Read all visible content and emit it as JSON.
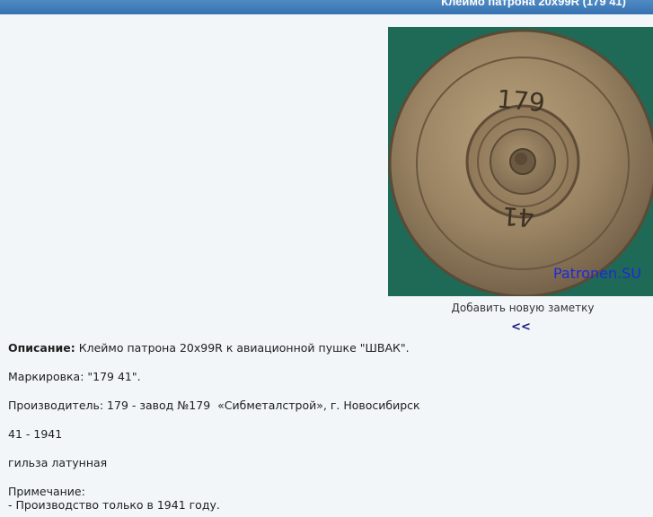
{
  "header": {
    "title": "Клеймо патрона 20x99R (179 41)"
  },
  "photo": {
    "watermark": "Patronen.SU",
    "stamp_top": "179",
    "stamp_bottom": "41"
  },
  "actions": {
    "add_note": "Добавить новую заметку",
    "back": "<<"
  },
  "description": {
    "label": "Описание:",
    "text": " Клеймо патрона 20x99R к авиационной пушке \"ШВАК\".",
    "marking": "Маркировка: \"179 41\".",
    "manufacturer": "Производитель: 179 - завод №179  «Сибметалстрой», г. Новосибирск",
    "year": "41 - 1941",
    "case": "гильза латунная",
    "note_label": "Примечание:",
    "note_text": "- Производство только в 1941 году."
  }
}
